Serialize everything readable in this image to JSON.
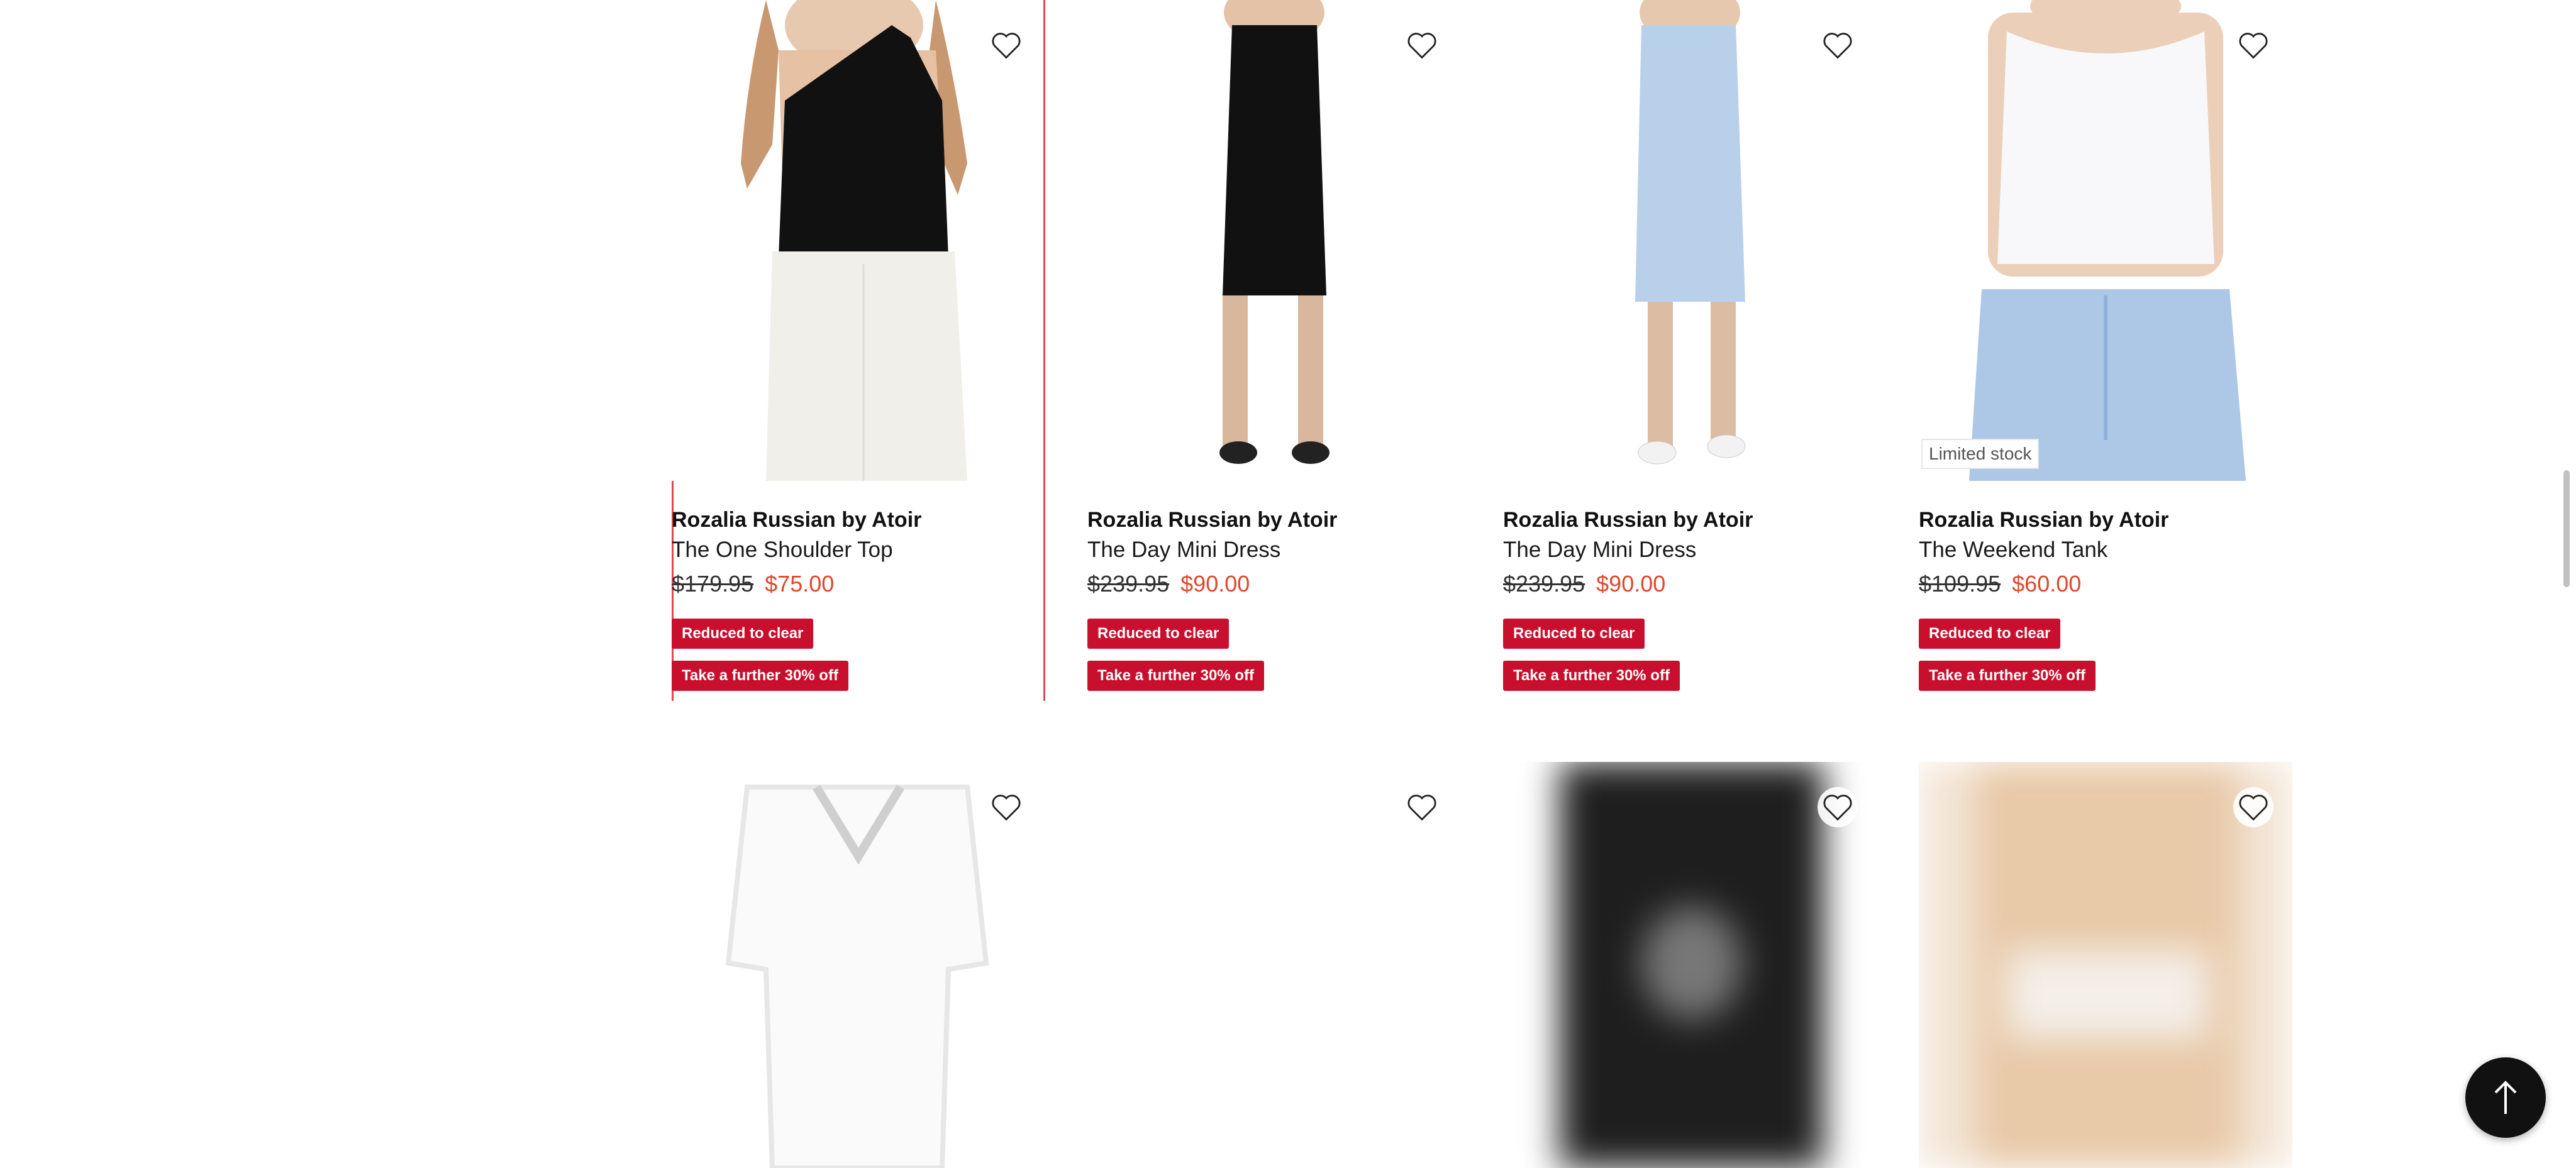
{
  "products_row1": [
    {
      "brand": "Rozalia Russian by Atoir",
      "title": "The One Shoulder Top",
      "was_price": "$179.95",
      "now_price": "$75.00",
      "tag1": "Reduced to clear",
      "tag2": "Take a further 30% off",
      "badge": ""
    },
    {
      "brand": "Rozalia Russian by Atoir",
      "title": "The Day Mini Dress",
      "was_price": "$239.95",
      "now_price": "$90.00",
      "tag1": "Reduced to clear",
      "tag2": "Take a further 30% off",
      "badge": ""
    },
    {
      "brand": "Rozalia Russian by Atoir",
      "title": "The Day Mini Dress",
      "was_price": "$239.95",
      "now_price": "$90.00",
      "tag1": "Reduced to clear",
      "tag2": "Take a further 30% off",
      "badge": ""
    },
    {
      "brand": "Rozalia Russian by Atoir",
      "title": "The Weekend Tank",
      "was_price": "$109.95",
      "now_price": "$60.00",
      "tag1": "Reduced to clear",
      "tag2": "Take a further 30% off",
      "badge": "Limited stock"
    }
  ],
  "icons": {
    "wishlist": "heart-outline-icon",
    "back_to_top": "arrow-up-icon"
  },
  "colors": {
    "sale_tag": "#c8102e",
    "now_price": "#e0472b",
    "focus_outline": "#e04a4a"
  }
}
